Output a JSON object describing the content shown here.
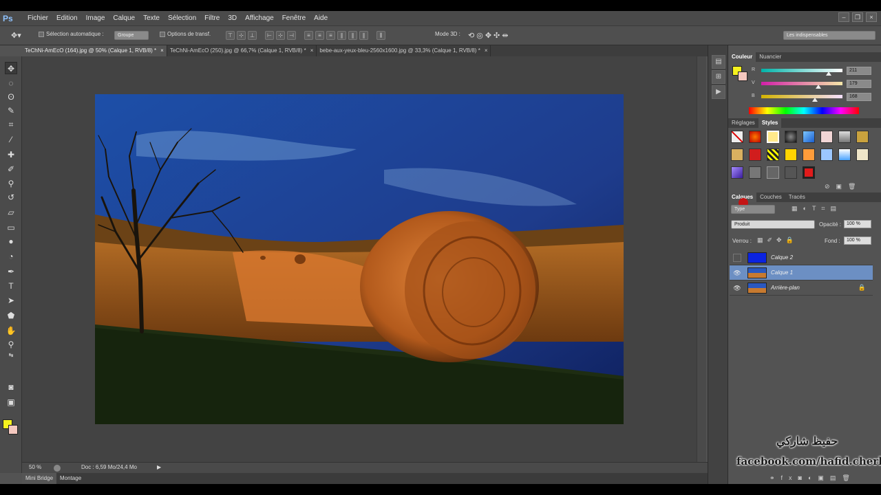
{
  "app": {
    "logo": "Ps"
  },
  "menu": [
    "Fichier",
    "Edition",
    "Image",
    "Calque",
    "Texte",
    "Sélection",
    "Filtre",
    "3D",
    "Affichage",
    "Fenêtre",
    "Aide"
  ],
  "options": {
    "auto_select": "Sélection automatique :",
    "auto_select_value": "Groupe",
    "transform": "Options de transf.",
    "mode3d": "Mode 3D :",
    "workspace": "Les indispensables"
  },
  "tabs": [
    {
      "label": "TeChNi-AmEcO (164).jpg @ 50% (Calque 1, RVB/8) *",
      "close": "×"
    },
    {
      "label": "TeChNi-AmEcO (250).jpg @ 66,7% (Calque 1, RVB/8) *",
      "close": "×"
    },
    {
      "label": "bebe-aux-yeux-bleu-2560x1600.jpg @ 33,3% (Calque 1, RVB/8) *",
      "close": "×"
    }
  ],
  "status": {
    "zoom": "50 %",
    "doc": "Doc : 6,59 Mo/24,4 Mo"
  },
  "bottom_tabs": [
    "Mini Bridge",
    "Montage"
  ],
  "color_panel": {
    "tabs": [
      "Couleur",
      "Nuancier"
    ],
    "r": "211",
    "g": "179",
    "b": "168",
    "r_label": "R",
    "g_label": "V",
    "b_label": "B",
    "r_value": 211,
    "g_value": 179,
    "b_value": 168
  },
  "styles_panel": {
    "tabs": [
      "Réglages",
      "Styles"
    ]
  },
  "layers_panel": {
    "tabs": [
      "Calques",
      "Couches",
      "Tracés"
    ],
    "kind": "Type",
    "blend": "Produit",
    "opacity_label": "Opacité :",
    "opacity": "100 %",
    "lock_label": "Verrou :",
    "fill_label": "Fond :",
    "fill": "100 %",
    "layers": [
      {
        "name": "Calque 2",
        "visible": false,
        "active": false
      },
      {
        "name": "Calque 1",
        "visible": true,
        "active": true
      },
      {
        "name": "Arrière-plan",
        "visible": true,
        "active": false,
        "locked": true
      }
    ]
  },
  "watermark": {
    "arabic": "حفيظ شاركي",
    "fb": "facebook.com/hafid.cherki"
  },
  "colors": {
    "fg": "#f6f21e",
    "bg": "#f4c8bf",
    "accent": "#6c8fc3"
  }
}
